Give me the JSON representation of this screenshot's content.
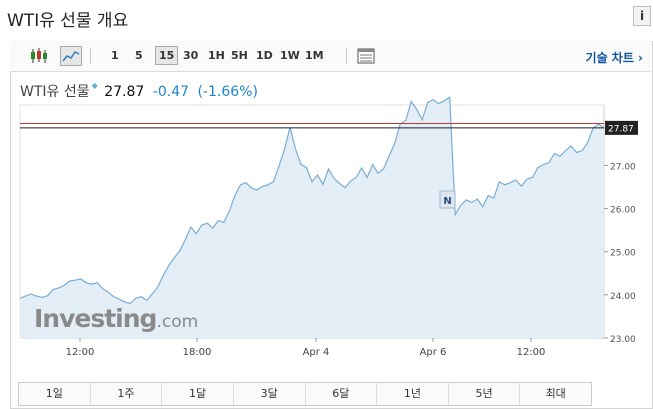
{
  "header": {
    "title": "WTI유 선물 개요",
    "info_label": "i"
  },
  "toolbar": {
    "periods": [
      "1",
      "5",
      "15",
      "30",
      "1H",
      "5H",
      "1D",
      "1W",
      "1M"
    ],
    "active_period": "15",
    "tech_chart_label": "기술 차트 ›",
    "icons": [
      "candlestick-icon",
      "line-chart-icon",
      "table-icon"
    ]
  },
  "quote": {
    "name": "WTI유 선물",
    "price": "27.87",
    "change": "-0.47",
    "change_pct": "(-1.66%)"
  },
  "chart_data": {
    "type": "area",
    "x_ticks": [
      "12:00",
      "18:00",
      "Apr 4",
      "Apr 6",
      "12:00"
    ],
    "y_ticks": [
      "23.00",
      "24.00",
      "25.00",
      "26.00",
      "27.00"
    ],
    "ylim": [
      23.0,
      28.4
    ],
    "current_value": "27.87",
    "reference_line": 27.97,
    "marker_label": "N",
    "watermark": "Investing.com",
    "colors": {
      "line": "#7aadd4",
      "fill": "#e3eef7",
      "ref": "#c0392b",
      "current": "#222222"
    },
    "values": [
      23.92,
      23.97,
      24.02,
      23.97,
      23.94,
      23.98,
      24.12,
      24.16,
      24.22,
      24.32,
      24.34,
      24.37,
      24.28,
      24.25,
      24.28,
      24.15,
      24.06,
      23.96,
      23.9,
      23.84,
      23.8,
      23.92,
      23.96,
      23.87,
      24.02,
      24.18,
      24.45,
      24.68,
      24.86,
      25.02,
      25.28,
      25.57,
      25.42,
      25.62,
      25.66,
      25.55,
      25.72,
      25.68,
      25.95,
      26.3,
      26.55,
      26.6,
      26.48,
      26.43,
      26.51,
      26.55,
      26.62,
      26.98,
      27.37,
      27.88,
      27.38,
      27.02,
      26.95,
      26.62,
      26.78,
      26.56,
      26.92,
      26.7,
      26.58,
      26.48,
      26.64,
      26.72,
      26.94,
      26.72,
      27.02,
      26.82,
      26.92,
      27.22,
      27.5,
      27.96,
      28.04,
      28.48,
      28.3,
      28.06,
      28.46,
      28.52,
      28.43,
      28.5,
      28.58,
      25.86,
      26.08,
      26.2,
      26.14,
      26.22,
      26.04,
      26.3,
      26.24,
      26.62,
      26.55,
      26.6,
      26.66,
      26.52,
      26.68,
      26.72,
      26.95,
      27.02,
      27.06,
      27.28,
      27.21,
      27.34,
      27.45,
      27.3,
      27.34,
      27.52,
      27.86,
      27.96,
      27.87
    ]
  },
  "range_buttons": [
    "1일",
    "1주",
    "1달",
    "3달",
    "6달",
    "1년",
    "5년",
    "최대"
  ]
}
